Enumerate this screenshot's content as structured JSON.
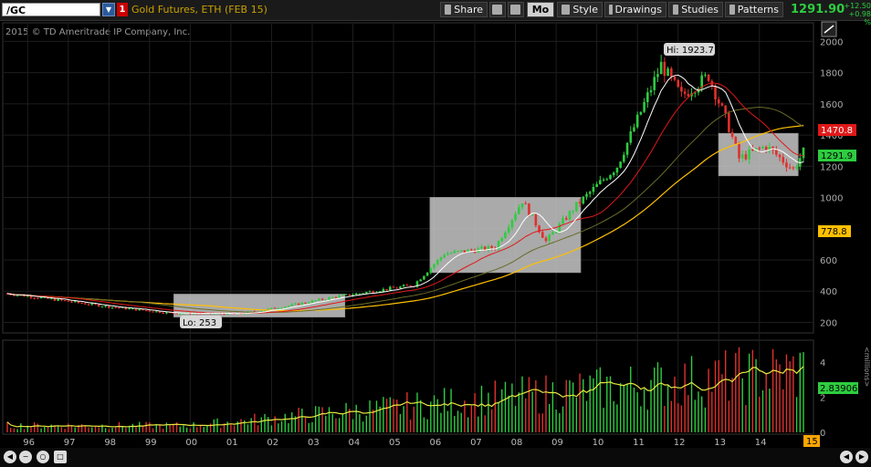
{
  "toolbar": {
    "symbol": "/GC",
    "alert_badge": "1",
    "description": "Gold Futures, ETH (FEB 15)",
    "share": "Share",
    "mo": "Mo",
    "style": "Style",
    "drawings": "Drawings",
    "studies": "Studies",
    "patterns": "Patterns",
    "last_price": "1291.90",
    "change": "+12.50",
    "change_pct": "+0.98 %"
  },
  "copyright": "2015 © TD Ameritrade IP Company, Inc.",
  "annotations": {
    "high": "Hi: 1923.7",
    "low": "Lo: 253"
  },
  "price_axis_labels": [
    "2000",
    "1800",
    "1600",
    "1400",
    "1200",
    "1000",
    "800",
    "600",
    "400",
    "200"
  ],
  "badges": {
    "ma_red": "1470.8",
    "last": "1291.9",
    "ma_yellow": "778.8",
    "volume": "2.83906"
  },
  "volume_axis_labels": [
    "4",
    "2",
    "0"
  ],
  "volume_axis_title": "<millions>",
  "x_axis_labels": [
    "96",
    "97",
    "98",
    "99",
    "00",
    "01",
    "02",
    "03",
    "04",
    "05",
    "06",
    "07",
    "08",
    "09",
    "10",
    "11",
    "12",
    "13",
    "14"
  ],
  "x_axis_current": "15",
  "colors": {
    "up": "#2ecc40",
    "down": "#e0302c",
    "ma_white": "#ffffff",
    "ma_red": "#e01818",
    "ma_olive": "#6b6b2a",
    "ma_yellow": "#ffc000",
    "vol_avg": "#e8e840"
  },
  "chart_data": {
    "type": "candlestick",
    "timeframe": "monthly",
    "x_range": [
      "1995-07",
      "2015-02"
    ],
    "price_range": [
      150,
      2090
    ],
    "price_anchors": [
      {
        "date": "1995-07",
        "price": 385
      },
      {
        "date": "1998-01",
        "price": 300
      },
      {
        "date": "1999-07",
        "price": 260
      },
      {
        "date": "2001-04",
        "price": 255
      },
      {
        "date": "2002-07",
        "price": 310
      },
      {
        "date": "2003-07",
        "price": 360
      },
      {
        "date": "2004-07",
        "price": 400
      },
      {
        "date": "2005-07",
        "price": 440
      },
      {
        "date": "2006-04",
        "price": 640
      },
      {
        "date": "2007-07",
        "price": 680
      },
      {
        "date": "2008-03",
        "price": 980
      },
      {
        "date": "2008-10",
        "price": 720
      },
      {
        "date": "2009-07",
        "price": 950
      },
      {
        "date": "2010-07",
        "price": 1200
      },
      {
        "date": "2011-08",
        "price": 1850
      },
      {
        "date": "2012-02",
        "price": 1650
      },
      {
        "date": "2012-10",
        "price": 1780
      },
      {
        "date": "2013-04",
        "price": 1450
      },
      {
        "date": "2013-07",
        "price": 1250
      },
      {
        "date": "2014-03",
        "price": 1330
      },
      {
        "date": "2014-11",
        "price": 1180
      },
      {
        "date": "2015-02",
        "price": 1292
      }
    ],
    "high": 1923.7,
    "low": 253,
    "last": 1291.9,
    "moving_averages": [
      {
        "color": "white",
        "last": null
      },
      {
        "color": "red",
        "last": 1470.8
      },
      {
        "color": "olive",
        "last": null
      },
      {
        "color": "yellow",
        "last": 778.8
      }
    ],
    "volume": {
      "unit": "millions",
      "last": 2.83906,
      "range": [
        0,
        5
      ]
    }
  }
}
